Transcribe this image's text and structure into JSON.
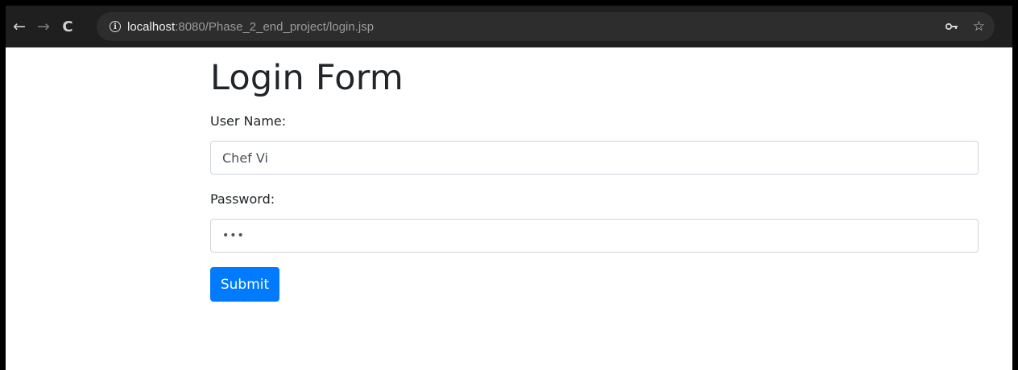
{
  "browser": {
    "back_icon": "arrow-left-icon",
    "forward_icon": "arrow-right-icon",
    "reload_icon": "reload-icon",
    "url_host": "localhost",
    "url_rest": ":8080/Phase_2_end_project/login.jsp",
    "key_icon": "key-icon",
    "star_icon": "star-icon"
  },
  "form": {
    "title": "Login Form",
    "username_label": "User Name:",
    "username_value": "Chef Vi",
    "password_label": "Password:",
    "password_value": "•••",
    "submit_label": "Submit"
  },
  "colors": {
    "accent": "#007bff",
    "toolbar": "#1f1f1f",
    "omnibox": "#2d2d2d"
  }
}
